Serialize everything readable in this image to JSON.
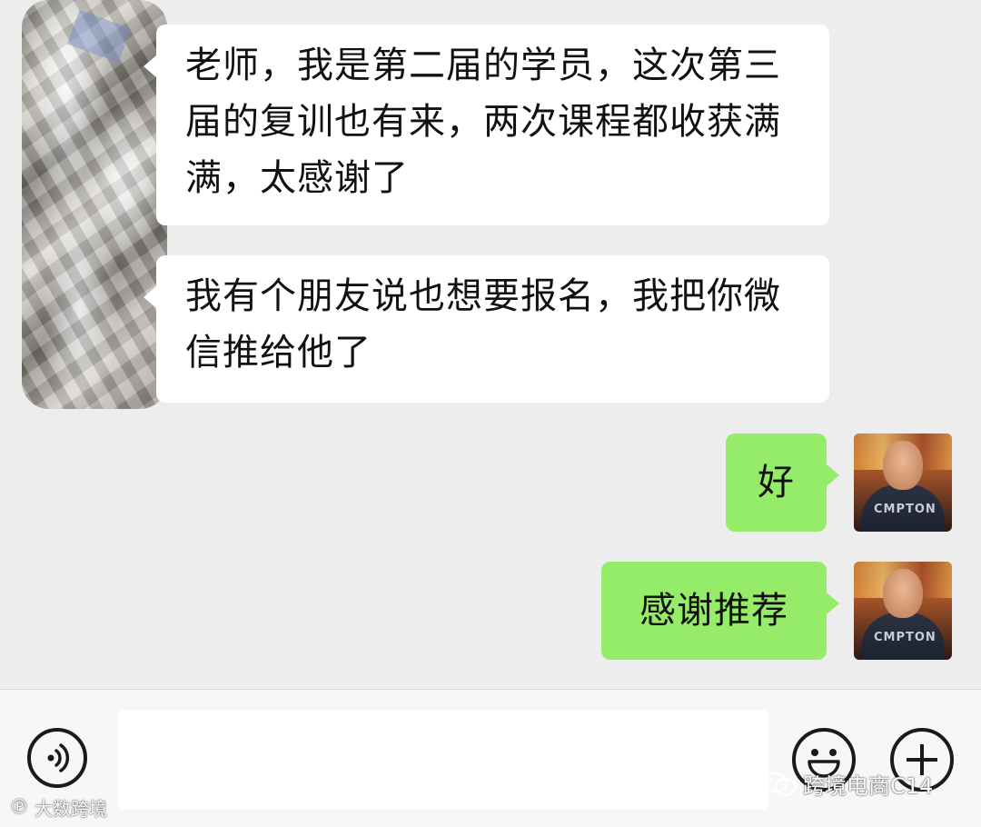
{
  "messages": [
    {
      "direction": "incoming",
      "text": "老师，我是第二届的学员，这次第三届的复训也有来，两次课程都收获满满，太感谢了"
    },
    {
      "direction": "incoming",
      "text": "我有个朋友说也想要报名，我把你微信推给他了"
    },
    {
      "direction": "outgoing",
      "text": "好"
    },
    {
      "direction": "outgoing",
      "text": "感谢推荐"
    }
  ],
  "avatar_right": {
    "shirt_text": "CMPTON"
  },
  "input_bar": {
    "voice_icon": "voice-icon",
    "emoji_icon": "emoji-icon",
    "plus_icon": "plus-icon",
    "input_value": ""
  },
  "watermarks": {
    "left": "大数跨境",
    "right": "跨境电商C14"
  },
  "colors": {
    "chat_bg": "#ededed",
    "incoming_bubble": "#ffffff",
    "outgoing_bubble": "#95ec69",
    "input_bar_bg": "#f7f7f7"
  }
}
